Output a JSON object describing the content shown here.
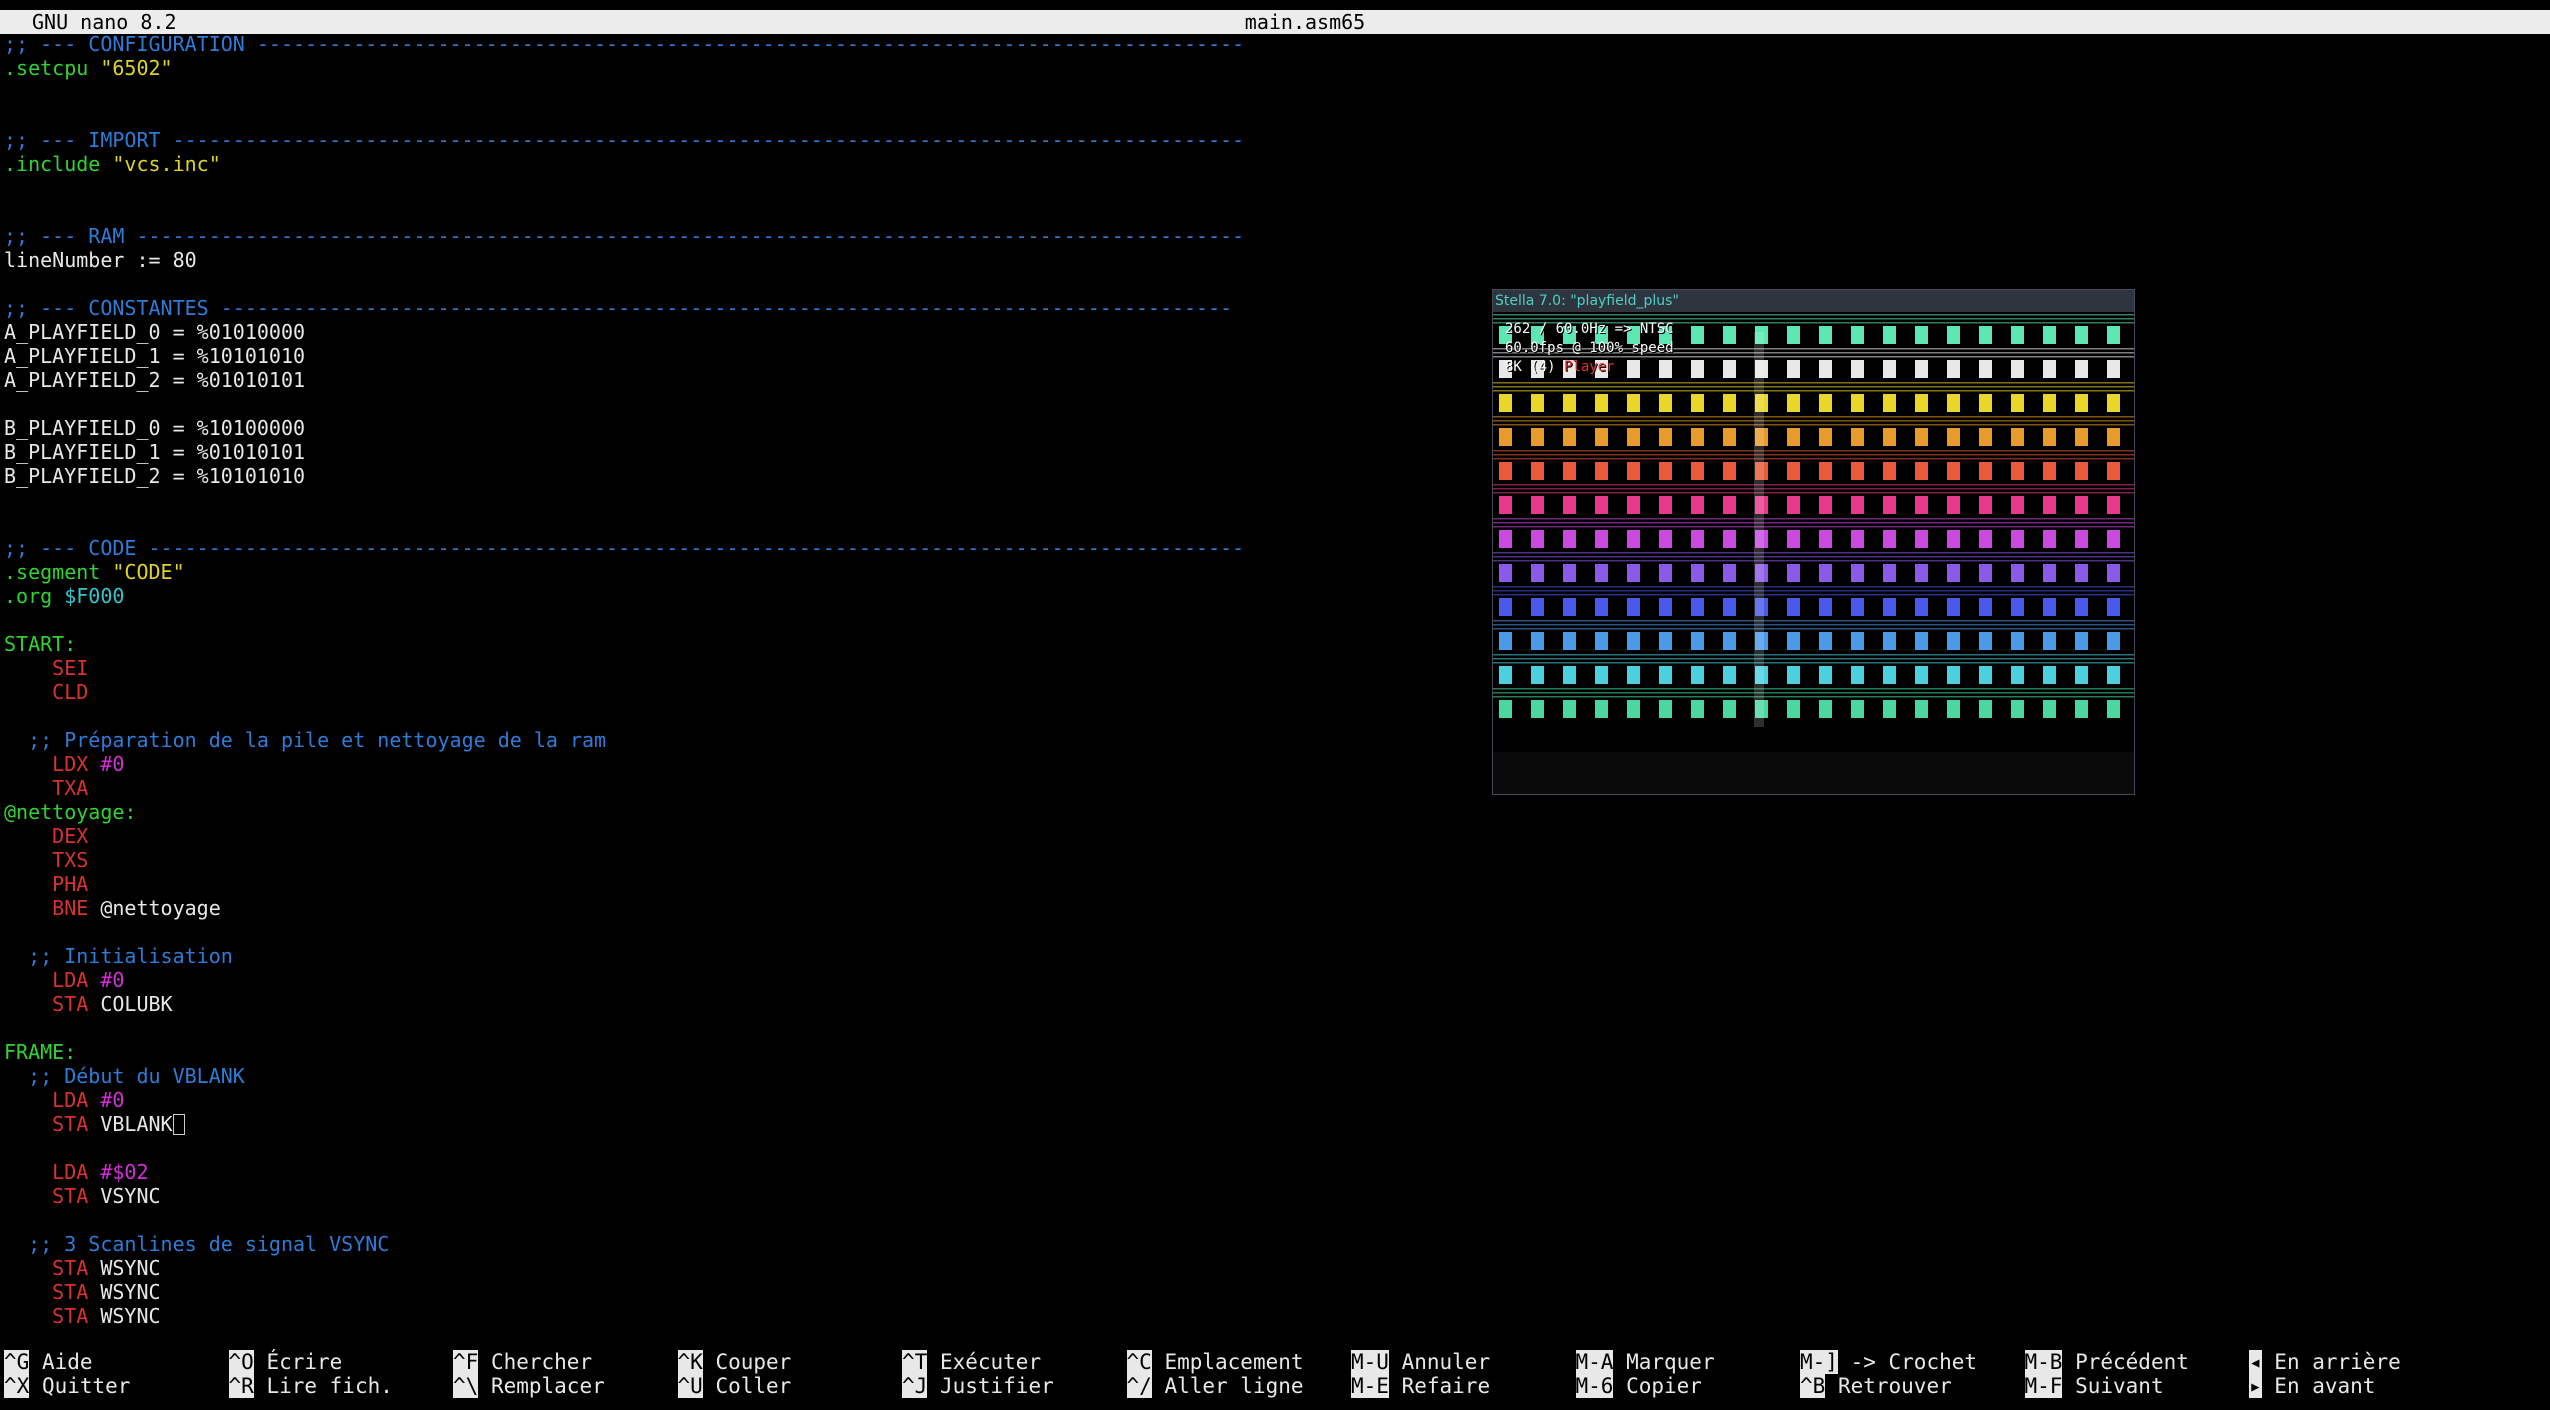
{
  "titlebar": {
    "app": "GNU nano 8.2",
    "file": "main.asm65"
  },
  "code_lines": [
    [
      {
        "t": ";; --- CONFIGURATION ----------------------------------------------------------------------------------",
        "c": "comment"
      }
    ],
    [
      {
        "t": ".setcpu ",
        "c": "dir"
      },
      {
        "t": "\"6502\"",
        "c": "str"
      }
    ],
    [],
    [],
    [
      {
        "t": ";; --- IMPORT -----------------------------------------------------------------------------------------",
        "c": "comment"
      }
    ],
    [
      {
        "t": ".include ",
        "c": "dir"
      },
      {
        "t": "\"vcs.inc\"",
        "c": "str"
      }
    ],
    [],
    [],
    [
      {
        "t": ";; --- RAM --------------------------------------------------------------------------------------------",
        "c": "comment"
      }
    ],
    [
      {
        "t": "lineNumber := 80",
        "c": "txt"
      }
    ],
    [],
    [
      {
        "t": ";; --- CONSTANTES ------------------------------------------------------------------------------------",
        "c": "comment"
      }
    ],
    [
      {
        "t": "A_PLAYFIELD_0 = %01010000",
        "c": "txt"
      }
    ],
    [
      {
        "t": "A_PLAYFIELD_1 = %10101010",
        "c": "txt"
      }
    ],
    [
      {
        "t": "A_PLAYFIELD_2 = %01010101",
        "c": "txt"
      }
    ],
    [],
    [
      {
        "t": "B_PLAYFIELD_0 = %10100000",
        "c": "txt"
      }
    ],
    [
      {
        "t": "B_PLAYFIELD_1 = %01010101",
        "c": "txt"
      }
    ],
    [
      {
        "t": "B_PLAYFIELD_2 = %10101010",
        "c": "txt"
      }
    ],
    [],
    [],
    [
      {
        "t": ";; --- CODE -------------------------------------------------------------------------------------------",
        "c": "comment"
      }
    ],
    [
      {
        "t": ".segment ",
        "c": "dir"
      },
      {
        "t": "\"CODE\"",
        "c": "str"
      }
    ],
    [
      {
        "t": ".org ",
        "c": "dir"
      },
      {
        "t": "$F000",
        "c": "hex"
      }
    ],
    [],
    [
      {
        "t": "START:",
        "c": "label"
      }
    ],
    [
      {
        "t": "    "
      },
      {
        "t": "SEI",
        "c": "kw"
      }
    ],
    [
      {
        "t": "    "
      },
      {
        "t": "CLD",
        "c": "kw"
      }
    ],
    [],
    [
      {
        "t": "  "
      },
      {
        "t": ";; Préparation de la pile et nettoyage de la ram",
        "c": "comment"
      }
    ],
    [
      {
        "t": "    "
      },
      {
        "t": "LDX ",
        "c": "kw"
      },
      {
        "t": "#0",
        "c": "num"
      }
    ],
    [
      {
        "t": "    "
      },
      {
        "t": "TXA",
        "c": "kw"
      }
    ],
    [
      {
        "t": "@nettoyage:",
        "c": "label"
      }
    ],
    [
      {
        "t": "    "
      },
      {
        "t": "DEX",
        "c": "kw"
      }
    ],
    [
      {
        "t": "    "
      },
      {
        "t": "TXS",
        "c": "kw"
      }
    ],
    [
      {
        "t": "    "
      },
      {
        "t": "PHA",
        "c": "kw"
      }
    ],
    [
      {
        "t": "    "
      },
      {
        "t": "BNE ",
        "c": "kw"
      },
      {
        "t": "@nettoyage",
        "c": "txt"
      }
    ],
    [],
    [
      {
        "t": "  "
      },
      {
        "t": ";; Initialisation",
        "c": "comment"
      }
    ],
    [
      {
        "t": "    "
      },
      {
        "t": "LDA ",
        "c": "kw"
      },
      {
        "t": "#0",
        "c": "num"
      }
    ],
    [
      {
        "t": "    "
      },
      {
        "t": "STA ",
        "c": "kw"
      },
      {
        "t": "COLUBK",
        "c": "txt"
      }
    ],
    [],
    [
      {
        "t": "FRAME:",
        "c": "label"
      }
    ],
    [
      {
        "t": "  "
      },
      {
        "t": ";; Début du VBLANK",
        "c": "comment"
      }
    ],
    [
      {
        "t": "    "
      },
      {
        "t": "LDA ",
        "c": "kw"
      },
      {
        "t": "#0",
        "c": "num"
      }
    ],
    [
      {
        "t": "    "
      },
      {
        "t": "STA ",
        "c": "kw"
      },
      {
        "t": "VBLANK",
        "c": "txt"
      },
      {
        "t": "",
        "c": "cursor"
      }
    ],
    [],
    [
      {
        "t": "    "
      },
      {
        "t": "LDA ",
        "c": "kw"
      },
      {
        "t": "#$02",
        "c": "num"
      }
    ],
    [
      {
        "t": "    "
      },
      {
        "t": "STA ",
        "c": "kw"
      },
      {
        "t": "VSYNC",
        "c": "txt"
      }
    ],
    [],
    [
      {
        "t": "  "
      },
      {
        "t": ";; 3 Scanlines de signal VSYNC",
        "c": "comment"
      }
    ],
    [
      {
        "t": "    "
      },
      {
        "t": "STA ",
        "c": "kw"
      },
      {
        "t": "WSYNC",
        "c": "txt"
      }
    ],
    [
      {
        "t": "    "
      },
      {
        "t": "STA ",
        "c": "kw"
      },
      {
        "t": "WSYNC",
        "c": "txt"
      }
    ],
    [
      {
        "t": "    "
      },
      {
        "t": "STA ",
        "c": "kw"
      },
      {
        "t": "WSYNC",
        "c": "txt"
      }
    ]
  ],
  "stella": {
    "title": "Stella 7.0: \"playfield_plus\"",
    "info_line1": "262 / 60.0Hz => NTSC",
    "info_line2": "60.0fps @ 100% speed",
    "info_line3_prefix": "8K (4) ",
    "info_line3_mode": "Player",
    "palette": [
      "#5be6b3",
      "#e8e8e8",
      "#e8d62a",
      "#e89a2a",
      "#e85a3a",
      "#e83a8a",
      "#c84ae0",
      "#8a5ae8",
      "#4a5ae8",
      "#4a9ae8",
      "#4ad0e0",
      "#4ad8a0"
    ]
  },
  "shortcuts": [
    {
      "k1": "^G",
      "l1": "Aide",
      "k2": "^X",
      "l2": "Quitter"
    },
    {
      "k1": "^O",
      "l1": "Écrire",
      "k2": "^R",
      "l2": "Lire fich."
    },
    {
      "k1": "^F",
      "l1": "Chercher",
      "k2": "^\\",
      "l2": "Remplacer"
    },
    {
      "k1": "^K",
      "l1": "Couper",
      "k2": "^U",
      "l2": "Coller"
    },
    {
      "k1": "^T",
      "l1": "Exécuter",
      "k2": "^J",
      "l2": "Justifier"
    },
    {
      "k1": "^C",
      "l1": "Emplacement",
      "k2": "^/",
      "l2": "Aller ligne"
    },
    {
      "k1": "M-U",
      "l1": "Annuler",
      "k2": "M-E",
      "l2": "Refaire"
    },
    {
      "k1": "M-A",
      "l1": "Marquer",
      "k2": "M-6",
      "l2": "Copier"
    },
    {
      "k1": "M-]",
      "l1": "-> Crochet",
      "k2": "^B",
      "l2": "Retrouver"
    },
    {
      "k1": "M-B",
      "l1": "Précédent",
      "k2": "M-F",
      "l2": "Suivant"
    },
    {
      "k1": "◂",
      "l1": "En arrière",
      "k2": "▸",
      "l2": "En avant"
    }
  ]
}
